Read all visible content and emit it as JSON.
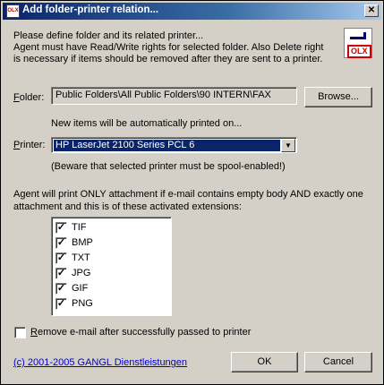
{
  "window": {
    "title": "Add folder-printer relation...",
    "icon_label": "OLX",
    "close_label": "✕"
  },
  "intro": [
    "Please define folder and its related printer...",
    "Agent must have Read/Write rights for selected folder. Also Delete right",
    "is necessary if items should be removed after they are sent to a printer."
  ],
  "logo": {
    "text": "OLX"
  },
  "folder": {
    "label_first": "F",
    "label_rest": "older:",
    "value": "Public Folders\\All Public Folders\\90 INTERN\\FAX",
    "browse_label": "Browse..."
  },
  "printer": {
    "hint": "New items will be automatically printed on...",
    "label_first": "P",
    "label_rest": "rinter:",
    "selected": "HP LaserJet 2100 Series PCL 6",
    "dropdown_glyph": "▼",
    "warning": "(Beware that selected printer must be spool-enabled!)"
  },
  "attachments": {
    "desc": [
      "Agent will print ONLY attachment if e-mail contains empty body AND exactly one",
      "attachment and this is of these activated extensions:"
    ],
    "extensions": [
      {
        "label": "TIF",
        "checked": true,
        "mark": "✓"
      },
      {
        "label": "BMP",
        "checked": true,
        "mark": "✓"
      },
      {
        "label": "TXT",
        "checked": true,
        "mark": "✓"
      },
      {
        "label": "JPG",
        "checked": true,
        "mark": "✓"
      },
      {
        "label": "GIF",
        "checked": true,
        "mark": "✓"
      },
      {
        "label": "PNG",
        "checked": true,
        "mark": "✓"
      }
    ]
  },
  "remove_option": {
    "label_first": "R",
    "label_rest": "emove e-mail after successfully passed to printer",
    "checked": false
  },
  "footer": {
    "copyright": "(c) 2001-2005 GANGL Dienstleistungen",
    "ok_label": "OK",
    "cancel_label": "Cancel"
  }
}
